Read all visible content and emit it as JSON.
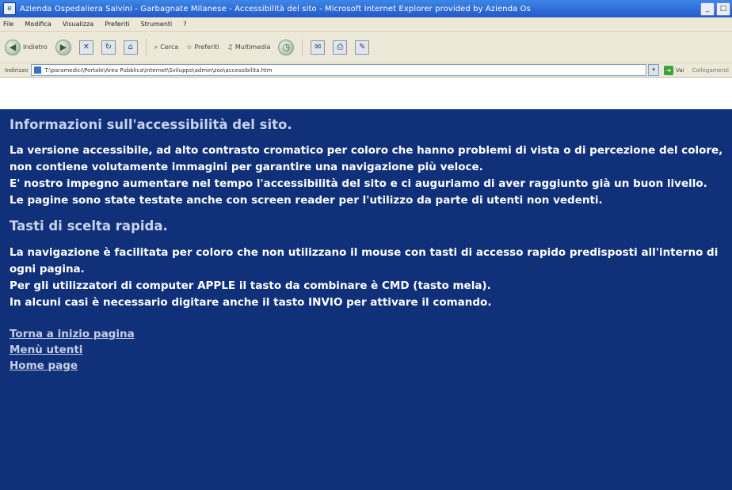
{
  "window": {
    "title": "Azienda Ospedaliera Salvini - Garbagnate Milanese - Accessibilità del sito - Microsoft Internet Explorer provided by Azienda Os"
  },
  "menu": [
    "File",
    "Modifica",
    "Visualizza",
    "Preferiti",
    "Strumenti",
    "?"
  ],
  "toolbar": {
    "back_label": "Indietro",
    "search_label": "Cerca",
    "favorites_label": "Preferiti",
    "multimedia_label": "Multimedia"
  },
  "address": {
    "label": "Indirizzo",
    "url": "T:\\paramedici\\Portale\\Area Pubblica\\Internet\\Sviluppo\\admin\\zoo\\accessibilita.htm",
    "go_label": "Vai",
    "links_label": "Collegamenti"
  },
  "content": {
    "heading1": "Informazioni sull'accessibilità del sito.",
    "para1": [
      "La versione accessibile, ad alto contrasto cromatico per coloro che hanno problemi di vista o di percezione del colore, non contiene volutamente immagini per garantire una navigazione più veloce.",
      "E' nostro impegno aumentare nel tempo l'accessibilità del sito e ci auguriamo di aver raggiunto già un buon livello.",
      "Le pagine sono state testate anche con screen reader per l'utilizzo da parte di utenti non vedenti."
    ],
    "heading2": "Tasti di scelta rapida.",
    "para2": [
      "La navigazione è facilitata per coloro che non utilizzano il mouse con tasti di accesso rapido predisposti all'interno di ogni pagina.",
      "Per gli utilizzatori di computer APPLE il tasto da combinare è CMD (tasto mela).",
      "In alcuni casi è necessario digitare anche il tasto INVIO per attivare il comando."
    ],
    "links": [
      "Torna a inizio pagina",
      "Menù utenti",
      "Home page"
    ]
  }
}
